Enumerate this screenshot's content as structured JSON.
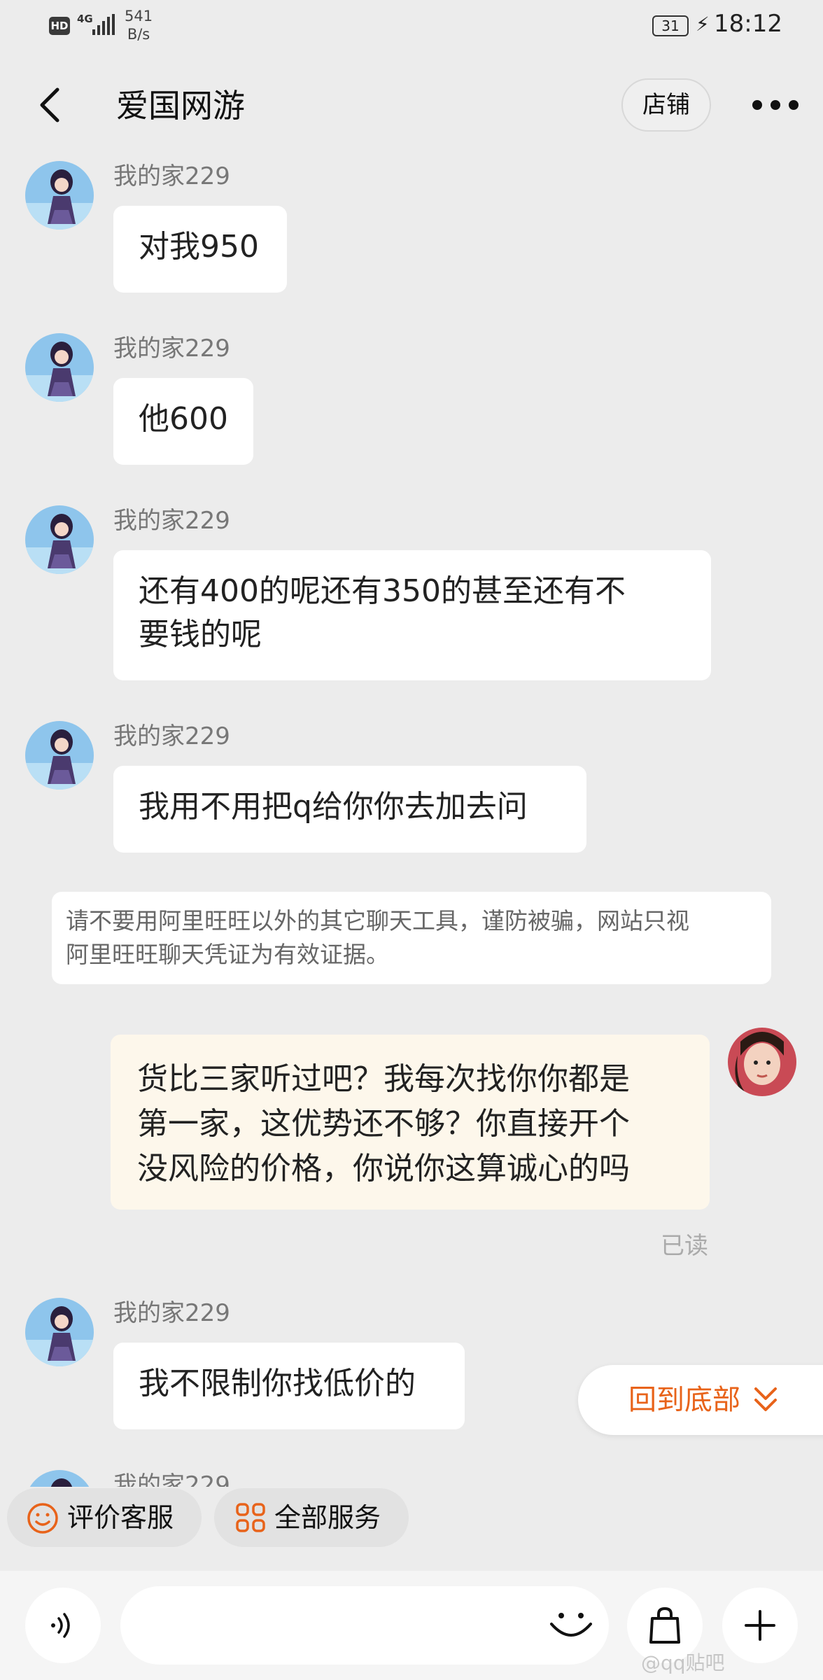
{
  "status_bar": {
    "hd": "HD",
    "network": "4G",
    "speed_value": "541",
    "speed_unit": "B/s",
    "battery": "31",
    "time": "18:12"
  },
  "header": {
    "title": "爱国网游",
    "shop_label": "店铺"
  },
  "messages": [
    {
      "sender": "我的家229",
      "text": "对我950"
    },
    {
      "sender": "我的家229",
      "text": "他600"
    },
    {
      "sender": "我的家229",
      "text_line1": "还有400的呢还有350的甚至还有不",
      "text_line2": "要钱的呢"
    },
    {
      "sender": "我的家229",
      "text": "我用不用把q给你你去加去问"
    },
    {
      "sender": "我的家229",
      "text": "我不限制你找低价的"
    },
    {
      "sender": "我的家229"
    }
  ],
  "notice": {
    "line1": "请不要用阿里旺旺以外的其它聊天工具，谨防被骗，网站只视",
    "line2": "阿里旺旺聊天凭证为有效证据。"
  },
  "my_message": {
    "line1": "货比三家听过吧？我每次找你你都是",
    "line2": "第一家，这优势还不够？你直接开个",
    "line3": "没风险的价格，你说你这算诚心的吗",
    "status": "已读"
  },
  "scroll_to_bottom": "回到底部",
  "chips": {
    "rate_service": "评价客服",
    "all_services": "全部服务"
  },
  "watermark": "@qq贴吧",
  "colors": {
    "accent": "#e8631a",
    "my_bubble": "#fdf7eb",
    "background": "#ececec"
  },
  "icons": [
    "back-arrow-icon",
    "more-dots-icon",
    "voice-icon",
    "emoji-icon",
    "shopping-bag-icon",
    "plus-icon",
    "smile-icon",
    "grid-services-icon",
    "chevron-double-down-icon"
  ]
}
